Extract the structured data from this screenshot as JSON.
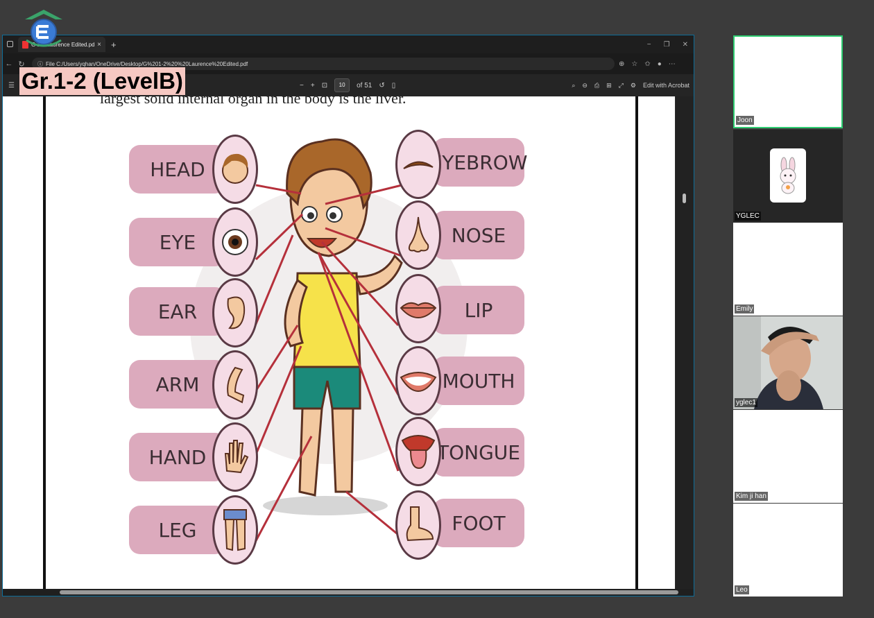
{
  "overlay": {
    "level_title": "Gr.1-2 (LevelB)",
    "logo_icon": "school-logo-icon"
  },
  "browser": {
    "tab_title": "G 1-2 Laurence Edited.pdf",
    "url": "File   C:/Users/yqhan/OneDrive/Desktop/G%201-2%20%20Laurence%20Edited.pdf",
    "pdf_toolbar": {
      "page_current": "10",
      "page_total": "of 51",
      "edit_acrobat": "Edit with Acrobat"
    }
  },
  "pdf_page": {
    "partial_text": "largest solid internal organ in the body is the liver.",
    "left_labels": [
      "HEAD",
      "EYE",
      "EAR",
      "ARM",
      "HAND",
      "LEG"
    ],
    "right_labels": [
      "EYEBROW",
      "NOSE",
      "LIP",
      "MOUTH",
      "TONGUE",
      "FOOT"
    ]
  },
  "participants": [
    {
      "name": "Joon"
    },
    {
      "name": "YGLEC"
    },
    {
      "name": "Emily"
    },
    {
      "name": "yglec1"
    },
    {
      "name": "Kim ji han"
    },
    {
      "name": "Leo"
    }
  ],
  "colors": {
    "label_pill": "#dcaabd",
    "level_title_bg": "#f6c8c2",
    "active_speaker_border": "#2ecc71"
  }
}
